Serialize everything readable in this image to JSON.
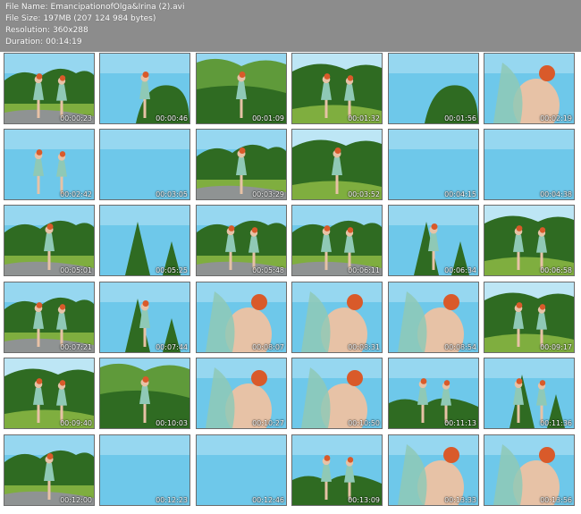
{
  "file_info": {
    "name_label": "File Name:",
    "name_value": "EmancipationofOlga&Irina (2).avi",
    "size_label": "File Size:",
    "size_value": "197MB (207 124 984 bytes)",
    "resolution_label": "Resolution:",
    "resolution_value": "360x288",
    "duration_label": "Duration:",
    "duration_value": "00:14:19"
  },
  "thumbnails": [
    {
      "time": "00:00:23",
      "scene": "road-trees-figures"
    },
    {
      "time": "00:00:46",
      "scene": "sky-bush-figure"
    },
    {
      "time": "00:01:09",
      "scene": "trees-figure"
    },
    {
      "time": "00:01:32",
      "scene": "forest-figures"
    },
    {
      "time": "00:01:56",
      "scene": "sky-bush"
    },
    {
      "time": "00:02:19",
      "scene": "sky-closeup-figures"
    },
    {
      "time": "00:02:42",
      "scene": "sky-figures"
    },
    {
      "time": "00:03:05",
      "scene": "sky"
    },
    {
      "time": "00:03:29",
      "scene": "road-trees-figure"
    },
    {
      "time": "00:03:52",
      "scene": "forest-figure"
    },
    {
      "time": "00:04:15",
      "scene": "sky"
    },
    {
      "time": "00:04:38",
      "scene": "sky"
    },
    {
      "time": "00:05:01",
      "scene": "road-trees-figure"
    },
    {
      "time": "00:05:25",
      "scene": "sky-spruce"
    },
    {
      "time": "00:05:48",
      "scene": "road-trees-figures"
    },
    {
      "time": "00:06:11",
      "scene": "road-trees-figures"
    },
    {
      "time": "00:06:34",
      "scene": "sky-spruce-figure"
    },
    {
      "time": "00:06:58",
      "scene": "forest-figures"
    },
    {
      "time": "00:07:21",
      "scene": "road-trees-figures"
    },
    {
      "time": "00:07:44",
      "scene": "sky-spruce-figure"
    },
    {
      "time": "00:08:07",
      "scene": "sky-closeup-figures"
    },
    {
      "time": "00:08:31",
      "scene": "sky-closeup-figures"
    },
    {
      "time": "00:08:54",
      "scene": "sky-closeup-figure"
    },
    {
      "time": "00:09:17",
      "scene": "forest-figures"
    },
    {
      "time": "00:09:40",
      "scene": "forest-figures"
    },
    {
      "time": "00:10:03",
      "scene": "trees-figure"
    },
    {
      "time": "00:10:27",
      "scene": "sky-closeup-figure"
    },
    {
      "time": "00:10:50",
      "scene": "sky-closeup-figure"
    },
    {
      "time": "00:11:13",
      "scene": "sky-trees-figures"
    },
    {
      "time": "00:11:36",
      "scene": "sky-spruce-figures"
    },
    {
      "time": "00:12:00",
      "scene": "road-trees-figure"
    },
    {
      "time": "00:12:23",
      "scene": "sky"
    },
    {
      "time": "00:12:46",
      "scene": "sky"
    },
    {
      "time": "00:13:09",
      "scene": "sky-trees-figures"
    },
    {
      "time": "00:13:33",
      "scene": "sky-closeup-figure"
    },
    {
      "time": "00:13:56",
      "scene": "sky-closeup-figures"
    }
  ],
  "colors": {
    "sky": "#6ec8ea",
    "sky_light": "#bde6f5",
    "foliage": "#2f6b22",
    "foliage_light": "#5f9a3a",
    "grass": "#7fae3f",
    "road": "#8f9393",
    "skin": "#e7c2a6",
    "dress": "#8fc9b6",
    "hair": "#d95a2a"
  }
}
